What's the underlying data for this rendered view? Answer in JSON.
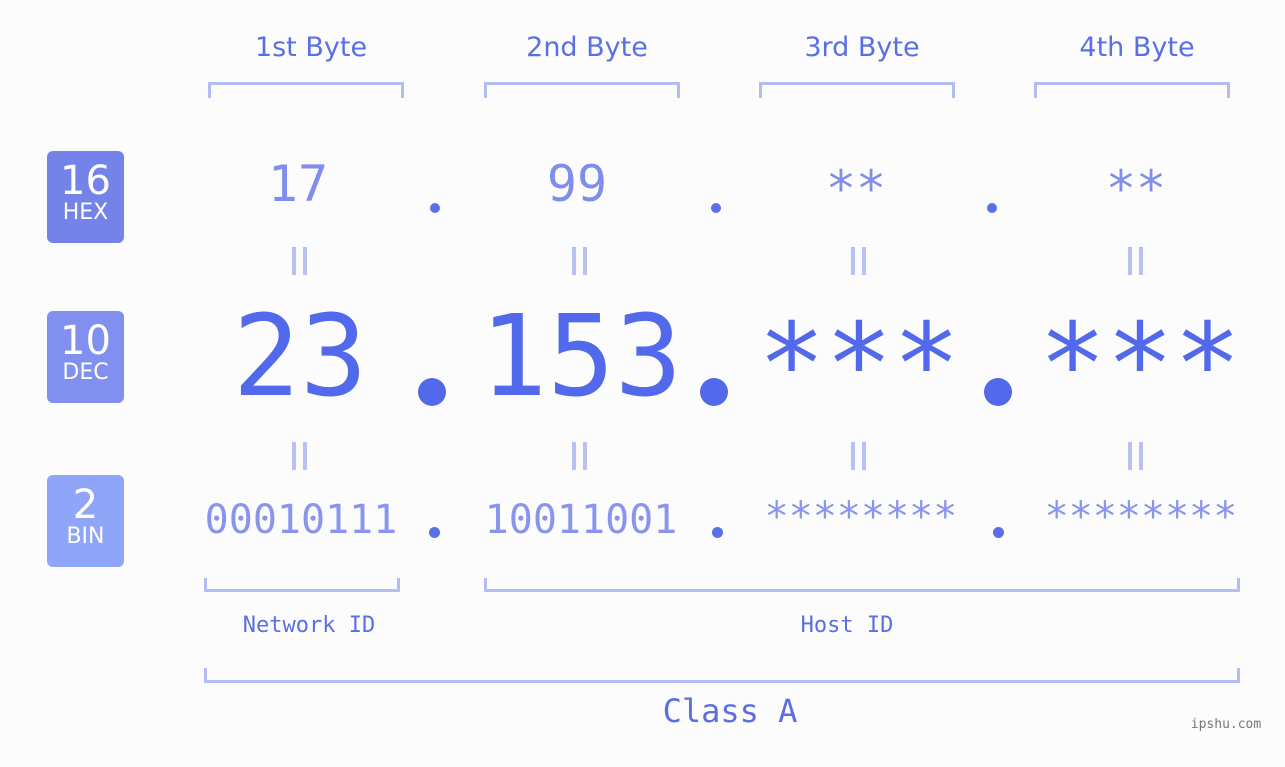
{
  "bases": [
    {
      "num": "16",
      "label": "HEX",
      "color": "#7383ea"
    },
    {
      "num": "10",
      "label": "DEC",
      "color": "#8190ef"
    },
    {
      "num": "2",
      "label": "BIN",
      "color": "#8fa5f8"
    }
  ],
  "byte_headers": [
    "1st Byte",
    "2nd Byte",
    "3rd Byte",
    "4th Byte"
  ],
  "hex": [
    "17",
    "99",
    "**",
    "**"
  ],
  "dec": [
    "23",
    "153",
    "***",
    "***"
  ],
  "bin": [
    "00010111",
    "10011001",
    "********",
    "********"
  ],
  "labels": {
    "network_id": "Network ID",
    "host_id": "Host ID",
    "class": "Class A"
  },
  "watermark": "ipshu.com"
}
